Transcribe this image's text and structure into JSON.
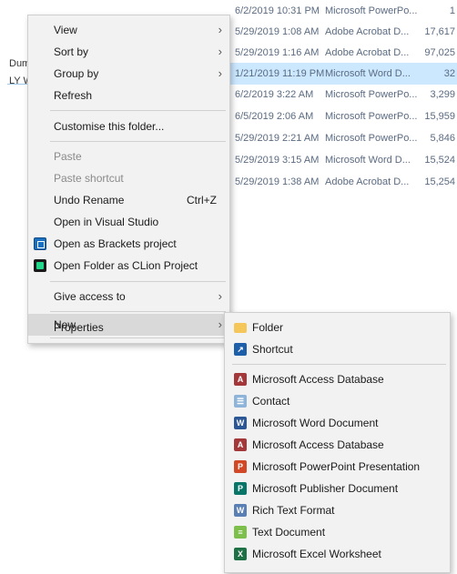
{
  "background": {
    "left_names": [
      "Dum",
      "LY W"
    ],
    "files": [
      {
        "date": "6/2/2019 10:31 PM",
        "type": "Microsoft PowerPo...",
        "size": "1",
        "selected": false
      },
      {
        "date": "5/29/2019 1:08 AM",
        "type": "Adobe Acrobat D...",
        "size": "17,617",
        "selected": false
      },
      {
        "date": "5/29/2019 1:16 AM",
        "type": "Adobe Acrobat D...",
        "size": "97,025",
        "selected": false
      },
      {
        "date": "1/21/2019 11:19 PM",
        "type": "Microsoft Word D...",
        "size": "32",
        "selected": true
      },
      {
        "date": "6/2/2019 3:22 AM",
        "type": "Microsoft PowerPo...",
        "size": "3,299",
        "selected": false
      },
      {
        "date": "6/5/2019 2:06 AM",
        "type": "Microsoft PowerPo...",
        "size": "15,959",
        "selected": false
      },
      {
        "date": "5/29/2019 2:21 AM",
        "type": "Microsoft PowerPo...",
        "size": "5,846",
        "selected": false
      },
      {
        "date": "5/29/2019 3:15 AM",
        "type": "Microsoft Word D...",
        "size": "15,524",
        "selected": false
      },
      {
        "date": "5/29/2019 1:38 AM",
        "type": "Adobe Acrobat D...",
        "size": "15,254",
        "selected": false
      }
    ]
  },
  "context_menu": {
    "view": "View",
    "sort_by": "Sort by",
    "group_by": "Group by",
    "refresh": "Refresh",
    "customise": "Customise this folder...",
    "paste": "Paste",
    "paste_shortcut": "Paste shortcut",
    "undo_rename": "Undo Rename",
    "undo_shortcut": "Ctrl+Z",
    "open_vs": "Open in Visual Studio",
    "open_brackets": "Open as Brackets project",
    "open_clion": "Open Folder as CLion Project",
    "give_access": "Give access to",
    "new": "New",
    "properties": "Properties",
    "arrow": "›"
  },
  "new_submenu": {
    "folder": "Folder",
    "shortcut": "Shortcut",
    "items": [
      {
        "label": "Microsoft Access Database",
        "icon": "access-icon"
      },
      {
        "label": "Contact",
        "icon": "contact-icon"
      },
      {
        "label": "Microsoft Word Document",
        "icon": "word-icon"
      },
      {
        "label": "Microsoft Access Database",
        "icon": "access-icon"
      },
      {
        "label": "Microsoft PowerPoint Presentation",
        "icon": "powerpoint-icon"
      },
      {
        "label": "Microsoft Publisher Document",
        "icon": "publisher-icon"
      },
      {
        "label": "Rich Text Format",
        "icon": "rtf-icon"
      },
      {
        "label": "Text Document",
        "icon": "text-document-icon"
      },
      {
        "label": "Microsoft Excel Worksheet",
        "icon": "excel-icon"
      }
    ]
  }
}
